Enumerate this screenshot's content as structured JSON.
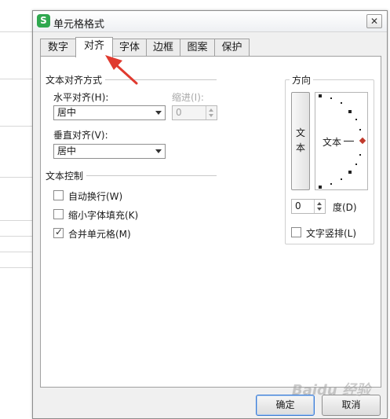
{
  "dialog": {
    "title": "单元格格式",
    "app_icon_letter": "S",
    "close_glyph": "✕"
  },
  "tabs": [
    {
      "label": "数字",
      "active": false
    },
    {
      "label": "对齐",
      "active": true
    },
    {
      "label": "字体",
      "active": false
    },
    {
      "label": "边框",
      "active": false
    },
    {
      "label": "图案",
      "active": false
    },
    {
      "label": "保护",
      "active": false
    }
  ],
  "alignment": {
    "section_title": "文本对齐方式",
    "horizontal_label": "水平对齐(H):",
    "horizontal_value": "居中",
    "indent_label": "缩进(I):",
    "indent_value": "0",
    "vertical_label": "垂直对齐(V):",
    "vertical_value": "居中"
  },
  "text_control": {
    "section_title": "文本控制",
    "wrap_text": {
      "label": "自动换行(W)",
      "checked": false
    },
    "shrink_to_fit": {
      "label": "缩小字体填充(K)",
      "checked": false
    },
    "merge_cells": {
      "label": "合并单元格(M)",
      "checked": true
    }
  },
  "orientation": {
    "section_title": "方向",
    "vertical_text_button": "文\n本",
    "dial_text": "文本",
    "degree_value": "0",
    "degree_label": "度(D)",
    "vertical_layout": {
      "label": "文字竖排(L)",
      "checked": false
    }
  },
  "buttons": {
    "ok": "确定",
    "cancel": "取消"
  },
  "watermark": "Baidu 经验",
  "colors": {
    "annotation_arrow": "#e03a2f",
    "app_icon": "#2fa84f"
  }
}
